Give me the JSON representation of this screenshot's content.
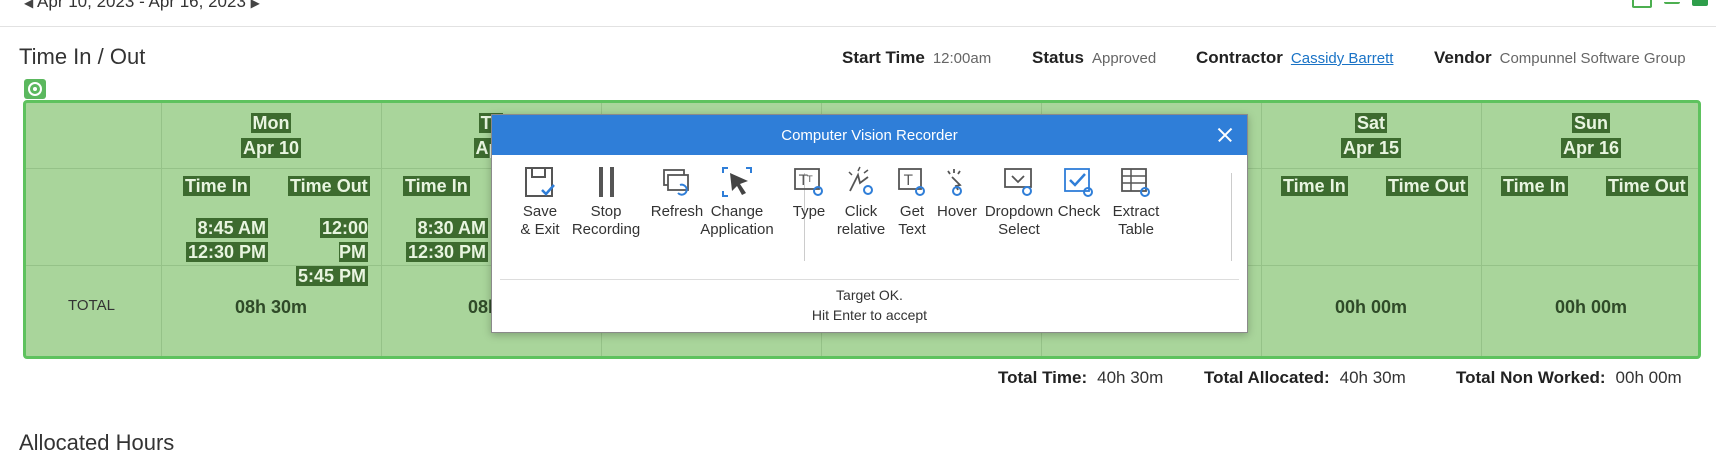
{
  "header": {
    "date_range": "Apr 10, 2023 - Apr 16, 2023",
    "page_title": "Time In / Out",
    "start_time_label": "Start Time",
    "start_time_value": "12:00am",
    "status_label": "Status",
    "status_value": "Approved",
    "contractor_label": "Contractor",
    "contractor_value": "Cassidy Barrett",
    "vendor_label": "Vendor",
    "vendor_value": "Compunnel Software Group"
  },
  "timesheet": {
    "total_label": "TOTAL",
    "time_in_label": "Time In",
    "time_out_label": "Time Out",
    "days": [
      {
        "dow": "Mon",
        "date": "Apr 10",
        "in1": "8:45 AM",
        "in2": "12:30 PM",
        "out1": "12:00 PM",
        "out2": "5:45 PM",
        "total": "08h 30m"
      },
      {
        "dow": "Tu",
        "date": "Apr",
        "in1": "8:30 AM",
        "in2": "12:30 PM",
        "out1": "",
        "out2": "",
        "total": "08h 3"
      },
      {
        "dow": "",
        "date": "",
        "in1": "",
        "in2": "",
        "out1": "",
        "out2": "",
        "total": ""
      },
      {
        "dow": "",
        "date": "",
        "in1": "",
        "in2": "",
        "out1": "",
        "out2": "",
        "total": ""
      },
      {
        "dow": "",
        "date": "",
        "in1": "",
        "in2": "",
        "out1": "",
        "out2": "",
        "total": ""
      },
      {
        "dow": "Sat",
        "date": "Apr 15",
        "in1": "",
        "in2": "",
        "out1": "",
        "out2": "",
        "total": "00h 00m"
      },
      {
        "dow": "Sun",
        "date": "Apr 16",
        "in1": "",
        "in2": "",
        "out1": "",
        "out2": "",
        "total": "00h 00m"
      }
    ]
  },
  "totals": {
    "total_time_label": "Total Time:",
    "total_time_value": "40h 30m",
    "total_allocated_label": "Total Allocated:",
    "total_allocated_value": "40h 30m",
    "total_non_worked_label": "Total Non Worked:",
    "total_non_worked_value": "00h 00m"
  },
  "allocated_section_title": "Allocated Hours",
  "recorder": {
    "title": "Computer Vision Recorder",
    "tools": [
      {
        "label1": "Save",
        "label2": "& Exit",
        "icon": "save-icon"
      },
      {
        "label1": "Stop",
        "label2": "Recording",
        "icon": "pause-icon"
      },
      {
        "label1": "Refresh",
        "label2": "",
        "icon": "refresh-icon"
      },
      {
        "label1": "Change",
        "label2": "Application",
        "icon": "cursor-icon"
      },
      {
        "label1": "Type",
        "label2": "",
        "icon": "type-icon"
      },
      {
        "label1": "Click",
        "label2": "relative",
        "icon": "click-icon"
      },
      {
        "label1": "Get",
        "label2": "Text",
        "icon": "get-text-icon"
      },
      {
        "label1": "Hover",
        "label2": "",
        "icon": "hover-icon"
      },
      {
        "label1": "Dropdown",
        "label2": "Select",
        "icon": "dropdown-icon"
      },
      {
        "label1": "Check",
        "label2": "",
        "icon": "check-icon"
      },
      {
        "label1": "Extract",
        "label2": "Table",
        "icon": "table-icon"
      }
    ],
    "status_line1": "Target OK.",
    "status_line2": "Hit Enter to accept"
  },
  "colors": {
    "grid_bg": "#a9d59b",
    "grid_border": "#5ec25e",
    "highlight": "#3d6b2f",
    "dialog_title": "#2f7ed8",
    "link": "#1a73c6"
  }
}
